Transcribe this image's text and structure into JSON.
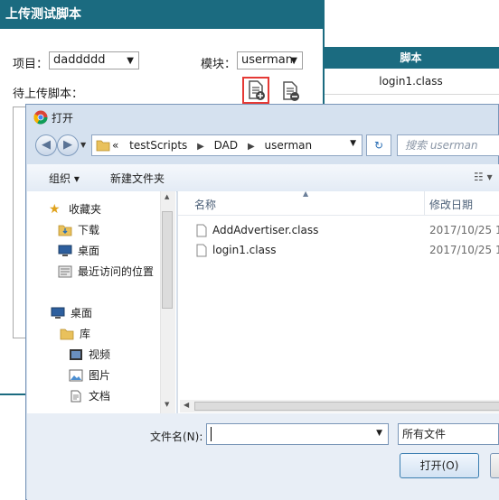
{
  "bg": {
    "dialog_title": "上传测试脚本",
    "project_label": "项目：",
    "project_value": "daddddd",
    "module_label": "模块：",
    "module_value": "userman",
    "pending_label": "待上传脚本：",
    "table_header": "脚本",
    "table_row": "login1.class"
  },
  "file_dialog": {
    "title": "打开",
    "breadcrumb_prefix": "«",
    "breadcrumbs": [
      "testScripts",
      "DAD",
      "userman"
    ],
    "search_placeholder": "搜索 userman",
    "toolbar": {
      "organize": "组织 ▾",
      "new_folder": "新建文件夹"
    },
    "nav_tree": {
      "favorites": "收藏夹",
      "downloads": "下载",
      "desktop_fav": "桌面",
      "recent": "最近访问的位置",
      "desktop": "桌面",
      "library": "库",
      "videos": "视频",
      "pictures": "图片",
      "documents": "文档"
    },
    "columns": {
      "name": "名称",
      "modified": "修改日期"
    },
    "files": [
      {
        "name": "AddAdvertiser.class",
        "date": "2017/10/25 1"
      },
      {
        "name": "login1.class",
        "date": "2017/10/25 1"
      }
    ],
    "filename_label": "文件名(N):",
    "filename_value": "",
    "filetype_value": "所有文件",
    "open_button": "打开(O)"
  },
  "colors": {
    "header_teal": "#1b6b80",
    "highlight_red": "#e53935",
    "dialog_bg": "#d5e1ef"
  }
}
